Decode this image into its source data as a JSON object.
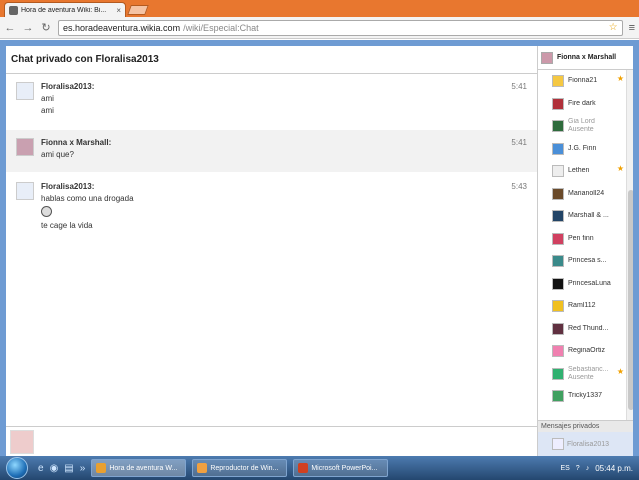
{
  "browser": {
    "tab_title": "Hora de aventura Wiki: Bi...",
    "tab_close": "×",
    "url_host": "es.horadeaventura.wikia.com",
    "url_path": "/wiki/Especial:Chat",
    "star": "☆",
    "back": "←",
    "forward": "→",
    "reload": "↻",
    "menu": "≡"
  },
  "chat": {
    "title": "Chat privado con Floralisa2013",
    "messages": [
      {
        "user": "Floralisa2013:",
        "time": "5:41",
        "lines": [
          "ami",
          "ami"
        ]
      },
      {
        "user": "Fionna x Marshall:",
        "time": "5:41",
        "lines": [
          "ami que?"
        ]
      },
      {
        "user": "Floralisa2013:",
        "time": "5:43",
        "lines": [
          "hablas como una drogada",
          "te cage la vida"
        ]
      }
    ]
  },
  "rail": {
    "current_user": "Fionna x Marshall",
    "users": [
      {
        "name": "Fionna21",
        "star": true,
        "color": "#f5c842"
      },
      {
        "name": "Fire dark",
        "color": "#b0303a"
      },
      {
        "name": "Gia Lord",
        "status": "Ausente",
        "away": true,
        "color": "#2e6b3c"
      },
      {
        "name": "J.G. Finn",
        "color": "#4a8fd8"
      },
      {
        "name": "Lethen",
        "star": true,
        "color": "#eeeeee"
      },
      {
        "name": "Marianoll24",
        "color": "#6a4a2a"
      },
      {
        "name": "Marshall & ...",
        "color": "#224466"
      },
      {
        "name": "Pen finn",
        "color": "#d04060"
      },
      {
        "name": "Princesa s...",
        "color": "#3a8a8a"
      },
      {
        "name": "PrincesaLuna",
        "color": "#111111"
      },
      {
        "name": "Raml112",
        "color": "#f0c020"
      },
      {
        "name": "Red Thund...",
        "color": "#603040"
      },
      {
        "name": "ReginaOrtiz",
        "color": "#f080b0"
      },
      {
        "name": "Sebastianc...",
        "status": "Ausente",
        "away": true,
        "star": true,
        "color": "#30b070"
      },
      {
        "name": "Tricky1337",
        "color": "#40a060"
      }
    ],
    "private_header": "Mensajes privados",
    "private_user": "Floralisa2013"
  },
  "taskbar": {
    "tasks": [
      {
        "label": "Hora de aventura W...",
        "color": "#e8a030",
        "active": true
      },
      {
        "label": "Reproductor de Win...",
        "color": "#f0a040"
      },
      {
        "label": "Microsoft PowerPoi...",
        "color": "#d04020"
      }
    ],
    "lang": "ES",
    "clock": "05:44 p.m."
  }
}
